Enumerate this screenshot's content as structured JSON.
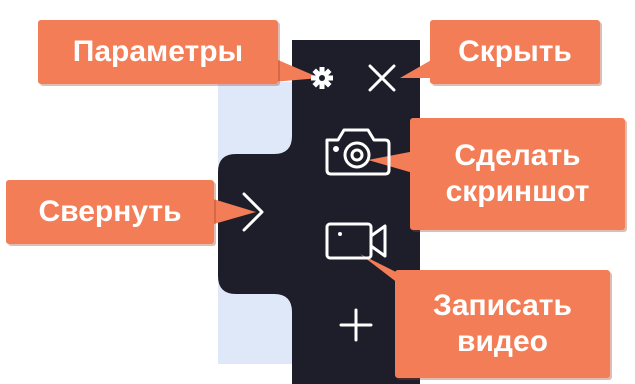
{
  "callouts": {
    "params": "Параметры",
    "hide": "Скрыть",
    "screenshot": "Сделать\nскриншот",
    "collapse": "Свернуть",
    "record": "Записать\nвидео"
  },
  "toolbar": {
    "settings_icon": "gear-icon",
    "close_icon": "close-icon",
    "screenshot_icon": "camera-icon",
    "record_icon": "video-camera-icon",
    "collapse_icon": "chevron-right-icon",
    "add_icon": "plus-icon"
  },
  "colors": {
    "toolbar_bg": "#1d1e2a",
    "icon": "#ffffff",
    "callout_bg": "#f27d56",
    "callout_text": "#ffffff",
    "backdrop": "#dfe8f8"
  }
}
